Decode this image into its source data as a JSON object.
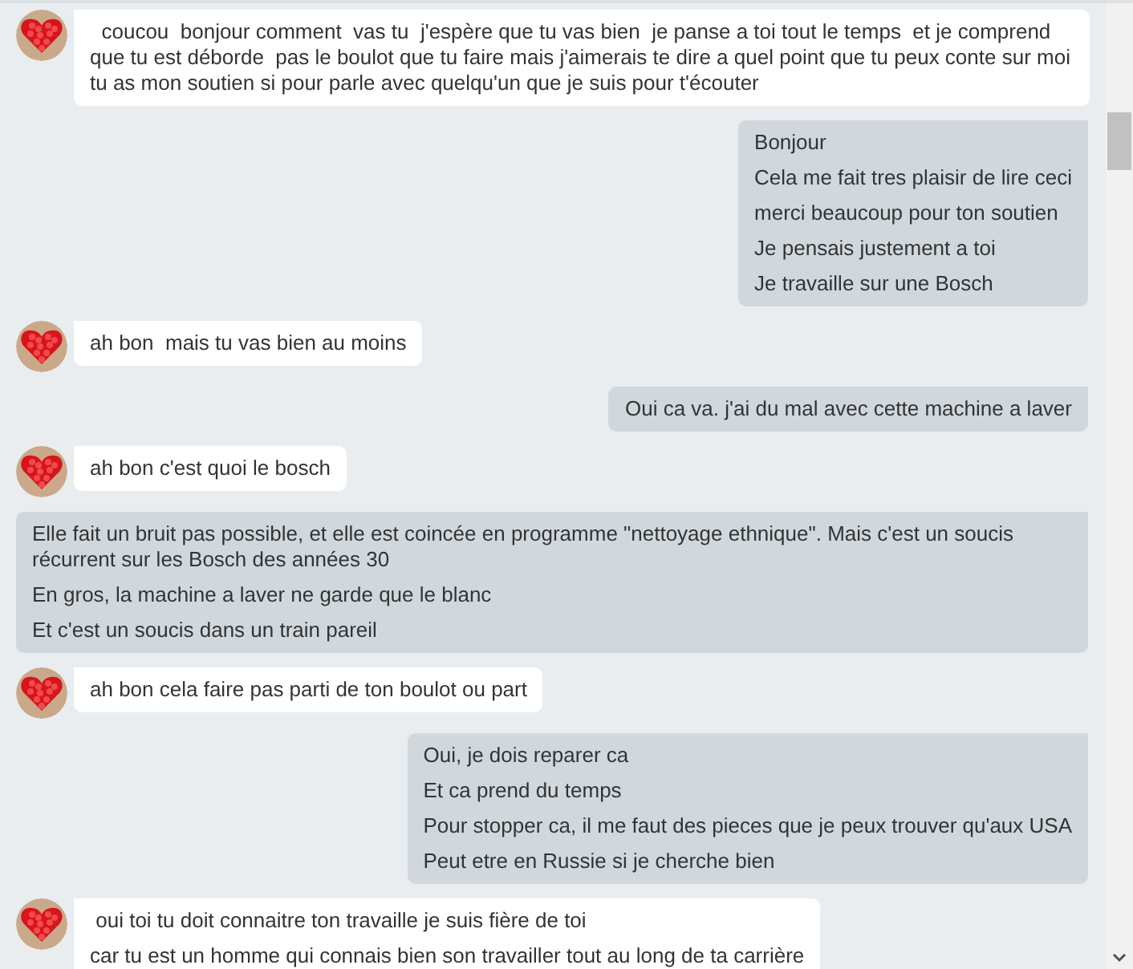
{
  "messages": [
    {
      "kind": "incoming",
      "paragraphs": [
        "  coucou  bonjour comment  vas tu  j'espère que tu vas bien  je panse a toi tout le temps  et je comprend que tu est déborde  pas le boulot que tu faire mais j'aimerais te dire a quel point que tu peux conte sur moi tu as mon soutien si pour parle avec quelqu'un que je suis pour t'écouter"
      ]
    },
    {
      "kind": "outgoing",
      "paragraphs": [
        "Bonjour",
        "Cela me fait tres plaisir de lire ceci",
        "merci beaucoup pour ton soutien",
        "Je pensais justement a toi",
        "Je travaille sur une Bosch"
      ]
    },
    {
      "kind": "incoming",
      "paragraphs": [
        "ah bon  mais tu vas bien au moins"
      ]
    },
    {
      "kind": "outgoing",
      "paragraphs": [
        "Oui ca va. j'ai du mal avec cette machine a laver"
      ]
    },
    {
      "kind": "incoming",
      "paragraphs": [
        "ah bon c'est quoi le bosch"
      ]
    },
    {
      "kind": "outgoing",
      "paragraphs": [
        "Elle fait un bruit pas possible, et elle est coincée en programme \"nettoyage ethnique\". Mais c'est un soucis récurrent sur les Bosch des années 30",
        "En gros, la machine a laver ne garde que le blanc",
        "Et c'est un soucis dans un train pareil"
      ]
    },
    {
      "kind": "incoming",
      "paragraphs": [
        "ah bon cela faire pas parti de ton boulot ou part"
      ]
    },
    {
      "kind": "outgoing",
      "paragraphs": [
        "Oui, je dois reparer ca",
        "Et ca prend du temps",
        "Pour stopper ca, il me faut des pieces que je peux trouver qu'aux USA",
        "Peut etre en Russie si je cherche bien"
      ]
    },
    {
      "kind": "incoming",
      "paragraphs": [
        " oui toi tu doit connaitre ton travaille je suis fière de toi",
        "car tu est un homme qui connais bien son travailler tout au long de ta carrière"
      ]
    }
  ]
}
